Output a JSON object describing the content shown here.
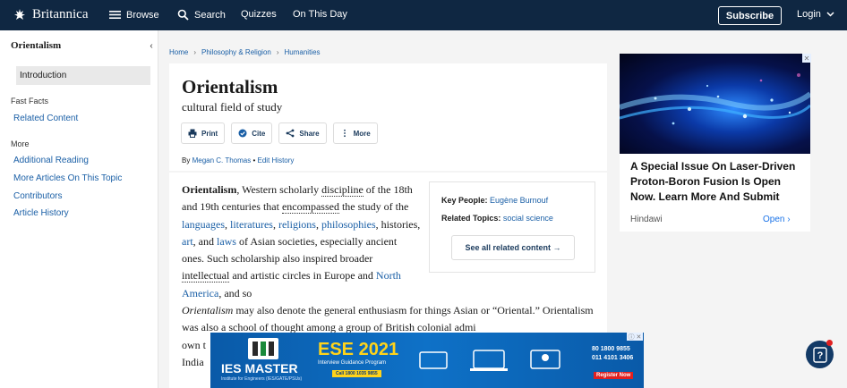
{
  "nav": {
    "brand": "Britannica",
    "browse": "Browse",
    "search": "Search",
    "quizzes": "Quizzes",
    "on_this_day": "On This Day",
    "subscribe": "Subscribe",
    "login": "Login"
  },
  "sidebar": {
    "title": "Orientalism",
    "active_item": "Introduction",
    "fast_facts_heading": "Fast Facts",
    "fast_facts": [
      "Related Content"
    ],
    "more_heading": "More",
    "more_items": [
      "Additional Reading",
      "More Articles On This Topic",
      "Contributors",
      "Article History"
    ]
  },
  "breadcrumb": [
    "Home",
    "Philosophy & Religion",
    "Humanities"
  ],
  "article": {
    "title": "Orientalism",
    "subtitle": "cultural field of study",
    "actions": [
      "Print",
      "Cite",
      "Share",
      "More"
    ],
    "byline_prefix": "By",
    "author": "Megan C. Thomas",
    "edit_history": "Edit History",
    "body": {
      "lead_term": "Orientalism",
      "t1": ", Western scholarly ",
      "discipline": "discipline",
      "t2": " of the 18th and 19th centuries that ",
      "encompassed": "encompassed",
      "t3": " the study of the ",
      "languages": "languages",
      "c1": ", ",
      "literatures": "literatures",
      "c2": ", ",
      "religions": "religions",
      "c3": ", ",
      "philosophies": "philosophies",
      "t4": ", histories, ",
      "art": "art",
      "t5": ", and ",
      "laws": "laws",
      "t6": " of Asian societies, especially ancient ones. Such scholarship also inspired broader ",
      "intellectual": "intellectual",
      "t7": " and artistic circles in Europe and ",
      "north_america": "North America",
      "t8": ", and so ",
      "orientalism_italic": "Orientalism",
      "t9": " may also denote the general enthusiasm for things Asian or “Oriental.” Orientalism was also a school of thought among a group of British colonial admi",
      "t10": "own t",
      "t11": "India"
    }
  },
  "facts": {
    "key_people_label": "Key People:",
    "key_people_value": "Eugène Burnouf",
    "related_topics_label": "Related Topics:",
    "related_topics_value": "social science",
    "see_all": "See all related content →"
  },
  "ad_right": {
    "headline": "A Special Issue On Laser-Driven Proton-Boron Fusion Is Open Now. Learn More And Submit",
    "source": "Hindawi",
    "cta": "Open",
    "close": "✕"
  },
  "banner": {
    "brand": "IES MASTER",
    "tagline": "Institute for Engineers (IES/GATE/PSUs)",
    "title": "ESE 2021",
    "program": "Interview Guidance Program",
    "code": "Call 1800 1035 9855",
    "phone1": "80 1800 9855",
    "phone2": "011 4101 3406",
    "register": "Register Now",
    "close": "ⓘ ✕"
  },
  "colors": {
    "nav_bg": "#0f2742",
    "link": "#1a5fa6",
    "banner_blue": "#0e71c7",
    "banner_yellow": "#ffd31a"
  }
}
